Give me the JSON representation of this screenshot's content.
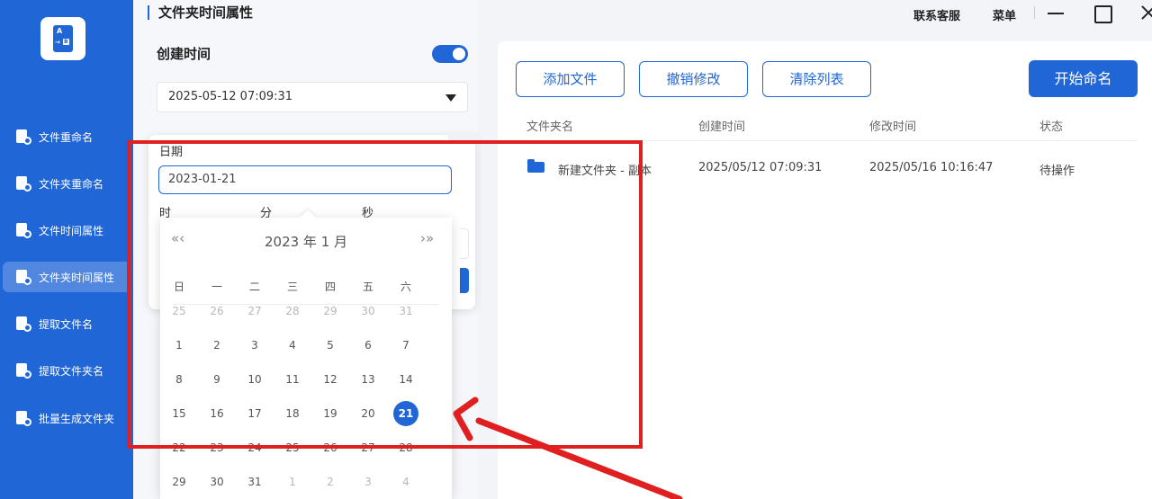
{
  "sidebar": {
    "logo_letters": [
      "A",
      "B"
    ],
    "items": [
      {
        "label": "文件重命名",
        "icon": "file-rename-icon"
      },
      {
        "label": "文件夹重命名",
        "icon": "folder-rename-icon"
      },
      {
        "label": "文件时间属性",
        "icon": "file-time-icon"
      },
      {
        "label": "文件夹时间属性",
        "icon": "folder-time-icon",
        "active": true
      },
      {
        "label": "提取文件名",
        "icon": "extract-filename-icon"
      },
      {
        "label": "提取文件夹名",
        "icon": "extract-foldername-icon"
      },
      {
        "label": "批量生成文件夹",
        "icon": "batch-folder-icon"
      }
    ]
  },
  "panel": {
    "title": "文件夹时间属性",
    "created_label": "创建时间",
    "toggle_on": true,
    "selected_time": "2025-05-12 07:09:31",
    "popup": {
      "date_label": "日期",
      "date_value": "2023-01-21",
      "hour_label": "时",
      "minute_label": "分",
      "second_label": "秒"
    }
  },
  "calendar": {
    "prev_label": "«‹",
    "next_label": "›»",
    "title": "2023 年  1 月",
    "weekdays": [
      "日",
      "一",
      "二",
      "三",
      "四",
      "五",
      "六"
    ],
    "weeks": [
      [
        {
          "d": "25",
          "dim": true
        },
        {
          "d": "26",
          "dim": true
        },
        {
          "d": "27",
          "dim": true
        },
        {
          "d": "28",
          "dim": true
        },
        {
          "d": "29",
          "dim": true
        },
        {
          "d": "30",
          "dim": true
        },
        {
          "d": "31",
          "dim": true
        }
      ],
      [
        {
          "d": "1"
        },
        {
          "d": "2"
        },
        {
          "d": "3"
        },
        {
          "d": "4"
        },
        {
          "d": "5"
        },
        {
          "d": "6"
        },
        {
          "d": "7"
        }
      ],
      [
        {
          "d": "8"
        },
        {
          "d": "9"
        },
        {
          "d": "10"
        },
        {
          "d": "11"
        },
        {
          "d": "12"
        },
        {
          "d": "13"
        },
        {
          "d": "14"
        }
      ],
      [
        {
          "d": "15"
        },
        {
          "d": "16"
        },
        {
          "d": "17"
        },
        {
          "d": "18"
        },
        {
          "d": "19"
        },
        {
          "d": "20"
        },
        {
          "d": "21",
          "selected": true
        }
      ],
      [
        {
          "d": "22"
        },
        {
          "d": "23"
        },
        {
          "d": "24"
        },
        {
          "d": "25"
        },
        {
          "d": "26"
        },
        {
          "d": "27"
        },
        {
          "d": "28"
        }
      ],
      [
        {
          "d": "29"
        },
        {
          "d": "30"
        },
        {
          "d": "31"
        },
        {
          "d": "1",
          "dim": true
        },
        {
          "d": "2",
          "dim": true
        },
        {
          "d": "3",
          "dim": true
        },
        {
          "d": "4",
          "dim": true
        }
      ]
    ]
  },
  "topbar": {
    "support": "联系客服",
    "menu": "菜单"
  },
  "toolbar": {
    "add_files": "添加文件",
    "undo_changes": "撤销修改",
    "clear_list": "清除列表",
    "start_rename": "开始命名"
  },
  "table": {
    "headers": [
      "文件夹名",
      "创建时间",
      "修改时间",
      "状态"
    ],
    "rows": [
      {
        "name": "新建文件夹 - 副本",
        "created": "2025/05/12 07:09:31",
        "modified": "2025/05/16 10:16:47",
        "status": "待操作"
      }
    ]
  },
  "colors": {
    "accent": "#2166d6",
    "annotation": "#e02020"
  }
}
